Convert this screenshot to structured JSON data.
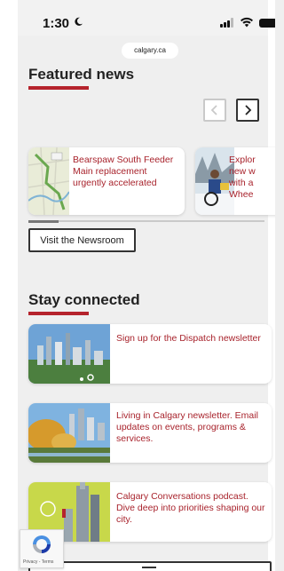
{
  "status_bar": {
    "time": "1:30",
    "icons": [
      "moon-icon",
      "signal-icon",
      "wifi-icon",
      "battery-icon"
    ]
  },
  "url_bar": {
    "domain": "calgary.ca"
  },
  "featured": {
    "heading": "Featured news",
    "cards": [
      {
        "title": "Bearspaw South Feeder Main replacement urgently accelerated"
      },
      {
        "title_lines": [
          "Explor",
          "new w",
          "with a",
          "Whee"
        ]
      }
    ],
    "newsroom_button": "Visit the Newsroom"
  },
  "stay_connected": {
    "heading": "Stay connected",
    "cards": [
      {
        "title": "Sign up for the Dispatch newsletter"
      },
      {
        "title": "Living in Calgary newsletter. Email updates on events, programs & services."
      },
      {
        "title": "Calgary Conversations podcast. Dive deep into priorities shaping our city."
      }
    ]
  },
  "recaptcha": {
    "label": "Privacy - Terms"
  },
  "colors": {
    "accent_red": "#b5232c",
    "link_red": "#a8232c"
  }
}
